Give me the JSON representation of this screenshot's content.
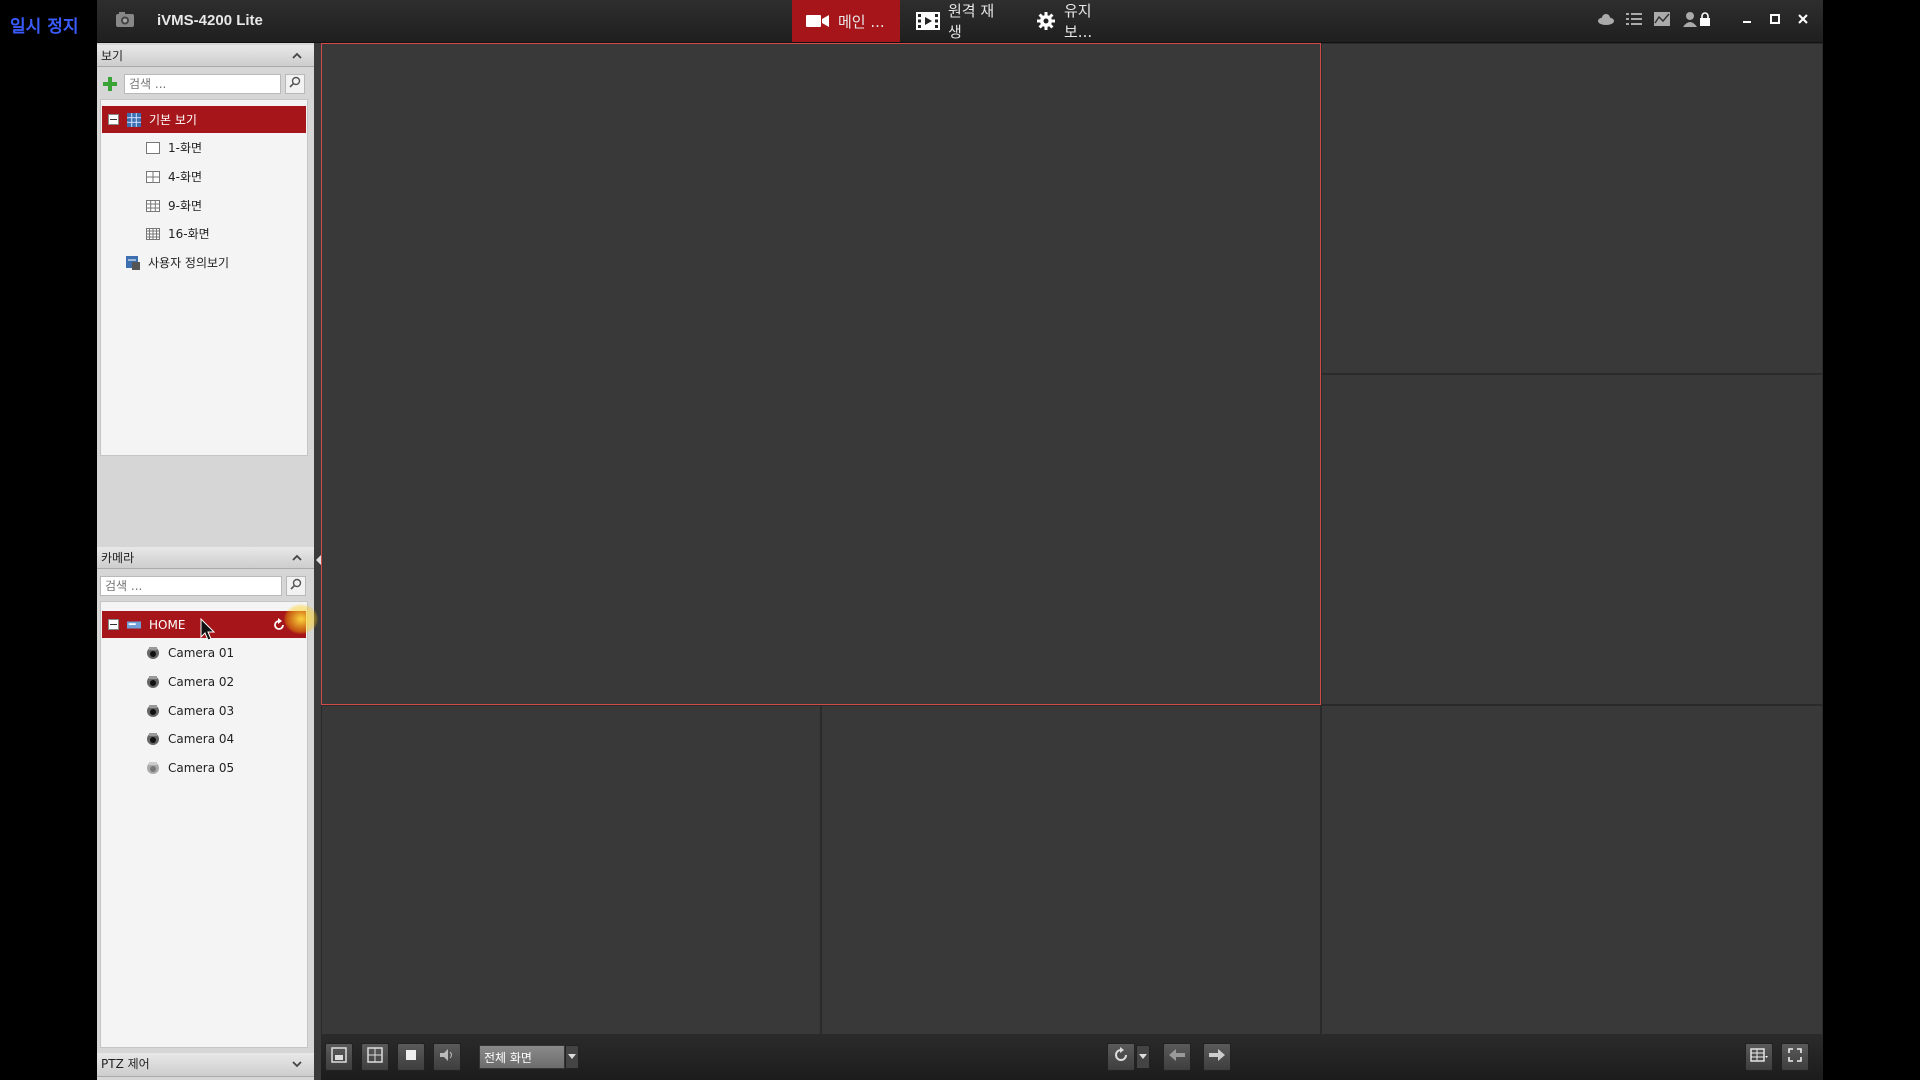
{
  "overlay": {
    "label": "일시 정지"
  },
  "titlebar": {
    "app_title": "iVMS-4200 Lite",
    "tabs": [
      {
        "label": "메인 ...",
        "icon": "video-camera-icon",
        "active": true
      },
      {
        "label": "원격 재생",
        "icon": "film-icon",
        "active": false
      },
      {
        "label": "유지 보...",
        "icon": "gear-icon",
        "active": false
      }
    ],
    "system_icons": [
      "cloud-icon",
      "list-icon",
      "chart-icon",
      "user-icon",
      "lock-icon"
    ],
    "window_buttons": [
      "minimize-icon",
      "maximize-icon",
      "close-icon"
    ]
  },
  "view_panel": {
    "title": "보기",
    "search_placeholder": "검색 ...",
    "root": {
      "label": "기본 보기",
      "expanded": true,
      "selected": true
    },
    "items": [
      {
        "label": "1-화면"
      },
      {
        "label": "4-화면"
      },
      {
        "label": "9-화면"
      },
      {
        "label": "16-화면"
      }
    ],
    "custom": {
      "label": "사용자 정의보기"
    }
  },
  "camera_panel": {
    "title": "카메라",
    "search_placeholder": "검색 ...",
    "root": {
      "label": "HOME",
      "expanded": true,
      "selected": true
    },
    "cameras": [
      {
        "label": "Camera 01"
      },
      {
        "label": "Camera 02"
      },
      {
        "label": "Camera 03"
      },
      {
        "label": "Camera 04"
      },
      {
        "label": "Camera 05"
      }
    ]
  },
  "ptz_panel": {
    "title": "PTZ 제어"
  },
  "toolbar": {
    "fullscreen_select": "전체 화면"
  },
  "colors": {
    "accent_red": "#a6151a",
    "selected_cell_border": "#d24a4a",
    "overlay_blue": "#3a5cff"
  }
}
